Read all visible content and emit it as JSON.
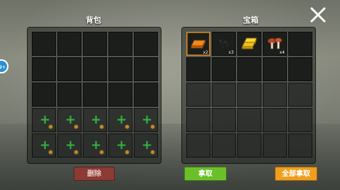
{
  "backpack": {
    "title": "背包",
    "unlocked_rows": 3,
    "locked_rows": 2,
    "delete_label": "删除"
  },
  "chest": {
    "title": "宝箱",
    "items": [
      {
        "name": "copper-ingot-icon",
        "qty": "x2"
      },
      {
        "name": "coal-icon",
        "qty": "x3"
      },
      {
        "name": "gold-ingot-icon",
        "qty": ""
      },
      {
        "name": "mushroom-icon",
        "qty": "x4"
      }
    ],
    "take_label": "拿取",
    "take_all_label": "全部拿取"
  },
  "level_badge": "2+",
  "colors": {
    "take_button": "#6bc02a",
    "take_all_button": "#ee9f1e",
    "delete_button": "#8b3b33",
    "unlock_plus": "#2ecc40"
  }
}
